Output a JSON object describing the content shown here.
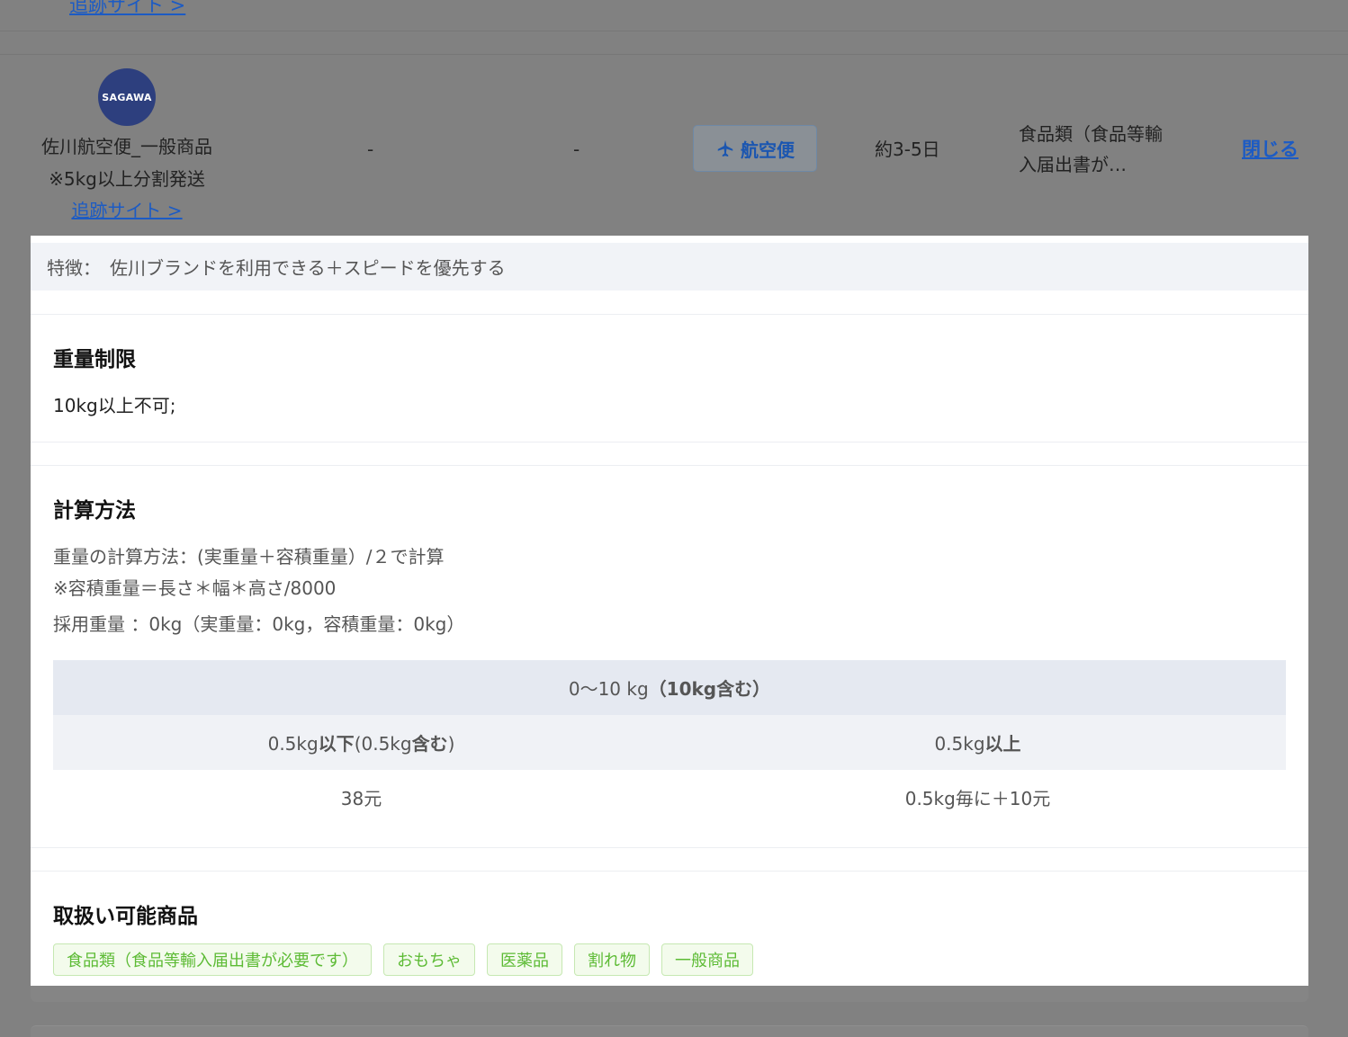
{
  "prev_row": {
    "track_link": "追跡サイト >"
  },
  "row": {
    "carrier_logo_text": "SAGAWA",
    "carrier_name": "佐川航空便_一般商品",
    "carrier_note": "※5kg以上分割発送",
    "track_link": "追跡サイト >",
    "col2": "-",
    "col3": "-",
    "mode_label": "航空便",
    "days": "約3-5日",
    "categories": "食品類（食品等輸入届出書が…",
    "close_label": "閉じる"
  },
  "detail": {
    "feature_label": "特徴：",
    "feature_text": "佐川ブランドを利用できる＋スピードを優先する",
    "weight_limit": {
      "title": "重量制限",
      "text": "10kg以上不可;"
    },
    "calc": {
      "title": "計算方法",
      "line1": "重量の計算方法：(実重量＋容積重量）/２で計算",
      "line2": "※容積重量＝長さ＊幅＊高さ/8000",
      "line3": "採用重量 ：0kg（実重量：0kg，容積重量：0kg）",
      "table": {
        "range_header_a": "0〜10 kg",
        "range_header_b": "（10kg含む）",
        "col1_header_a": "0.5kg",
        "col1_header_b": "以下",
        "col1_header_c": "(0.5kg",
        "col1_header_d": "含む",
        "col1_header_e": ")",
        "col2_header_a": "0.5kg",
        "col2_header_b": "以上",
        "col1_value": "38元",
        "col2_value": "0.5kg毎に＋10元"
      }
    },
    "goods": {
      "title": "取扱い可能商品",
      "tags": [
        "食品類（食品等輸入届出書が必要です）",
        "おもちゃ",
        "医薬品",
        "割れ物",
        "一般商品"
      ]
    }
  },
  "colors": {
    "link": "#1c5bc4",
    "tag_text": "#5dbb35",
    "tag_bg": "#f3fbec",
    "overlay": "#818181"
  }
}
